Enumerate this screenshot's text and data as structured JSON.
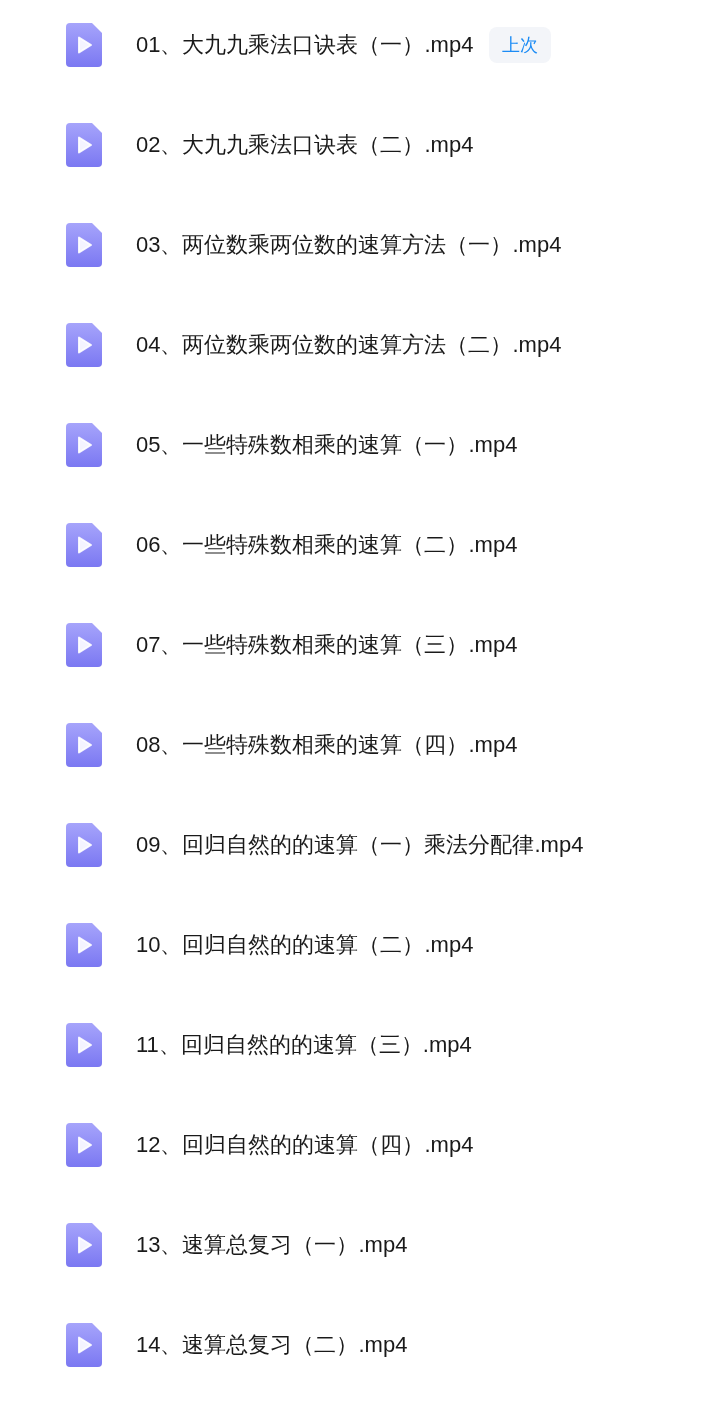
{
  "files": [
    {
      "name": "01、大九九乘法口诀表（一）.mp4",
      "badge": "上次"
    },
    {
      "name": "02、大九九乘法口诀表（二）.mp4"
    },
    {
      "name": "03、两位数乘两位数的速算方法（一）.mp4"
    },
    {
      "name": "04、两位数乘两位数的速算方法（二）.mp4"
    },
    {
      "name": "05、一些特殊数相乘的速算（一）.mp4"
    },
    {
      "name": "06、一些特殊数相乘的速算（二）.mp4"
    },
    {
      "name": "07、一些特殊数相乘的速算（三）.mp4"
    },
    {
      "name": "08、一些特殊数相乘的速算（四）.mp4"
    },
    {
      "name": "09、回归自然的的速算（一）乘法分配律.mp4"
    },
    {
      "name": "10、回归自然的的速算（二）.mp4"
    },
    {
      "name": "11、回归自然的的速算（三）.mp4"
    },
    {
      "name": "12、回归自然的的速算（四）.mp4"
    },
    {
      "name": "13、速算总复习（一）.mp4"
    },
    {
      "name": "14、速算总复习（二）.mp4"
    }
  ]
}
